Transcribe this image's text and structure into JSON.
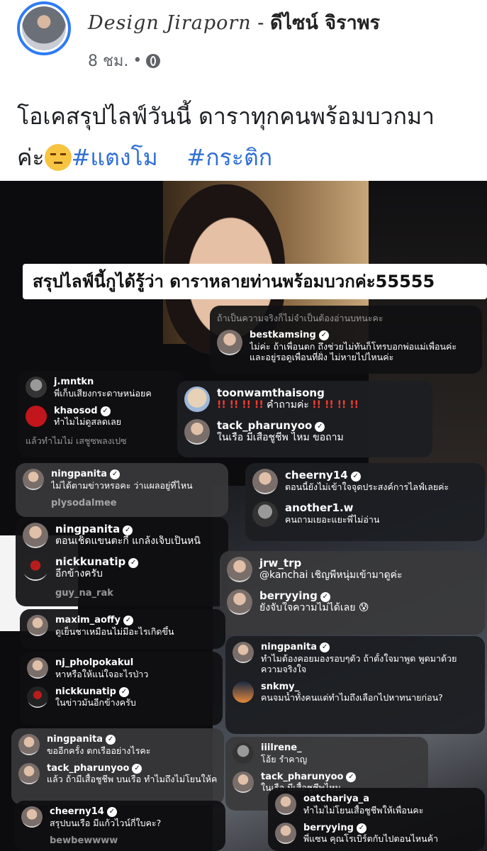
{
  "post": {
    "author_latin": "Design Jiraporn",
    "author_separator": " - ",
    "author_thai": "ดีไซน์ จิราพร",
    "time": "8 ชม.",
    "time_dot": " • ",
    "text_line1": "โอเคสรุปไลฟ์วันนี้ ดาราทุกคนพร้อมบวกมา",
    "text_line2_prefix": "ค่ะ",
    "hashtags": [
      "#แตงโม",
      "#กระติก"
    ]
  },
  "banner": {
    "text": "สรุปไลฟ์นี้กูได้รู้ว่า ดาราหลายท่านพร้อมบวกค่ะ55555"
  },
  "comments": {
    "c01": {
      "user": "",
      "text": "ถ้าเป็นความจริงก็ไม่จำเป็นต้องอ่านบทนะคะ"
    },
    "c02": {
      "user": "bestkamsing",
      "verified": true,
      "text": "ไม่ค่ะ ถ้าเพื่อนตก ถึงช่วยไม่ทันก็โทรบอกพ่อแม่เพื่อนค่ะ",
      "text2": "และอยู่รอดูเพื่อนที่ฝั่ง ไม่หายไปไหนค่ะ"
    },
    "c03": {
      "user": "j.mntkn",
      "text": "พี่เก็บเสียงกระดาษหน่อยค"
    },
    "c04": {
      "user": "khaosod",
      "verified": true,
      "text": "ทำไมไม่ดูสลดเลย"
    },
    "c05": {
      "user": "",
      "text": "แล้วทำไมไม่ เสชูซพลงเปซ"
    },
    "c06": {
      "user": "toonwamthaisong",
      "text_mid": "คำถามค่ะ",
      "marks": "!! !! !! !!"
    },
    "c07": {
      "user": "tack_pharunyoo",
      "verified": true,
      "text": "ในเรือ มีเสื้อชูชีพ ไหม ขอถาม"
    },
    "c08": {
      "user": "ningpanita",
      "verified": true,
      "text": "ไม่ได้ตามข่าวหรอคะ ว่าแผลอยู่ที่ไหน"
    },
    "c09": {
      "user": "plysodalmee",
      "text": ""
    },
    "c10": {
      "user": "cheerny14",
      "verified": true,
      "text": "ตอนนี้ยังไม่เข้าใจจุดประสงค์การไลฟ์เลยค่ะ"
    },
    "c11": {
      "user": "another1.w",
      "text": "คนถามเยอะแยะพี่ไม่อ่าน"
    },
    "c12": {
      "user": "ningpanita",
      "verified": true,
      "text": "ตอนเช็ดแขนตะกี้ แกล้งเจ็บเป็นหนิ"
    },
    "c13": {
      "user": "nickkunatip",
      "verified": true,
      "text": "อีกข้างครับ"
    },
    "c14": {
      "user": "guy_na_rak",
      "text": ""
    },
    "c15": {
      "user": "jrw_trp",
      "text": "@kanchai เชิญพี่หนุ่มเข้ามาดูค่ะ"
    },
    "c16": {
      "user": "berryying",
      "verified": true,
      "text": "ยังจับใจความไม่ได้เลย 😰"
    },
    "c17": {
      "user": "maxim_aoffy",
      "verified": true,
      "text": "ดูเย็นชาเหมือนไม่มีอะไรเกิดขึ้น"
    },
    "c18": {
      "user": "ningpanita",
      "verified": true,
      "text": "ทำไมต้องคอยมองรอบๆตัว ถ้าตั้งใจมาพูด พูดมาด้วย",
      "text2": "ความจริงใจ"
    },
    "c19": {
      "user": "nj_pholpokakul",
      "text": "หาหรือให้แน่ใจอะไรป่าว"
    },
    "c20": {
      "user": "snkmy_",
      "text": "คนจมน้ำทั้งคนแต่ทำไมถึงเลือกไปหาทนายก่อน?"
    },
    "c21": {
      "user": "nickkunatip",
      "verified": true,
      "text": "ในข่าวมันอีกข้างครับ"
    },
    "c22": {
      "user": "iiilrene_",
      "text": "โอ้ย รำคาญ"
    },
    "c23": {
      "user": "ningpanita",
      "verified": true,
      "text": "ขออีกครั้ง ตกเรืออย่างไรคะ"
    },
    "c24": {
      "user": "tack_pharunyoo",
      "verified": true,
      "text": "ในเรือ มีเสื้อชูชีพไหม....."
    },
    "c25": {
      "user": "tack_pharunyoo",
      "verified": true,
      "text": "แล้ว ถ้ามีเสื้อชูชีพ บนเรือ ทำไมถึงไม่โยนให้ครับ"
    },
    "c26": {
      "user": "oatchariya_a",
      "text": "ทำไมไม่โยนเสื้อชูชีพให้เพื่อนคะ"
    },
    "c27": {
      "user": "cheerny14",
      "verified": true,
      "text": "สรุปบนเรือ มีแก้วไวน์กี่ใบคะ?"
    },
    "c28": {
      "user": "berryying",
      "verified": true,
      "text": "พี่แซน คุณโรเบิร์ตกับไปตอนไหนค้า"
    },
    "c29": {
      "user": "bewbewwww",
      "text": ""
    }
  },
  "badge_glyph": "✓"
}
